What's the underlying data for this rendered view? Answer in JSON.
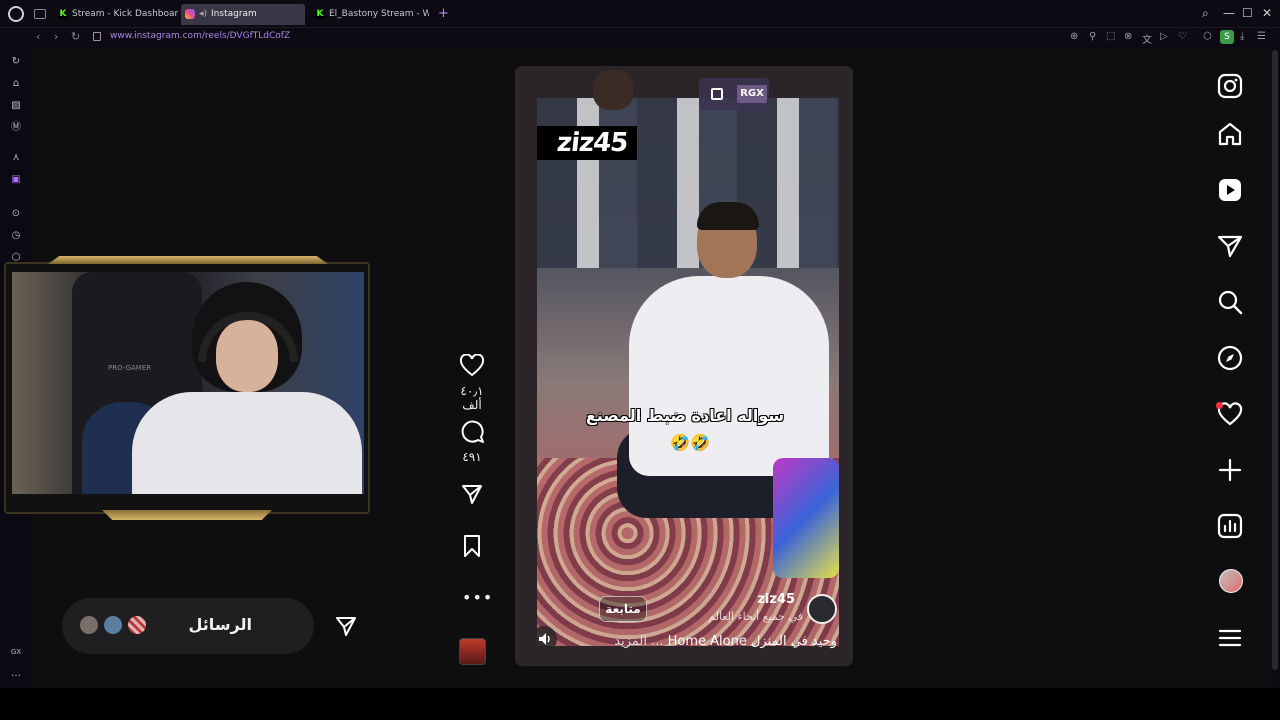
{
  "browser": {
    "tabs": [
      {
        "title": "Stream - Kick Dashboard",
        "favicon": "kick-icon",
        "active": false
      },
      {
        "title": "Instagram",
        "favicon": "instagram-icon",
        "active": true,
        "playing_audio": true
      },
      {
        "title": "El_Bastony Stream - Watc",
        "favicon": "kick-icon",
        "active": false
      }
    ],
    "url": "www.instagram.com/reels/DVGfTLdCofZ",
    "profile_initial": "S"
  },
  "reel": {
    "watermark": "ziz45",
    "logo_badge": "RGX",
    "caption_overlay": "سواله اعادة ضبط المصنع",
    "caption_overlay_emoji": "🤣🤣",
    "owner": "ziz45",
    "follow_label": "متابعة",
    "audio_label": "في جميع أنحاء العالم",
    "caption": "وحيد في المنزل Home Alone",
    "caption_more": "... المزيد"
  },
  "actions": {
    "likes": "٤٠٫١ ألف",
    "comments": "٤٩١"
  },
  "messages": {
    "label": "الرسائل"
  },
  "colors": {
    "accent_purple": "#a688e8",
    "kick_green": "#53fc18",
    "notification_red": "#ff3040"
  }
}
